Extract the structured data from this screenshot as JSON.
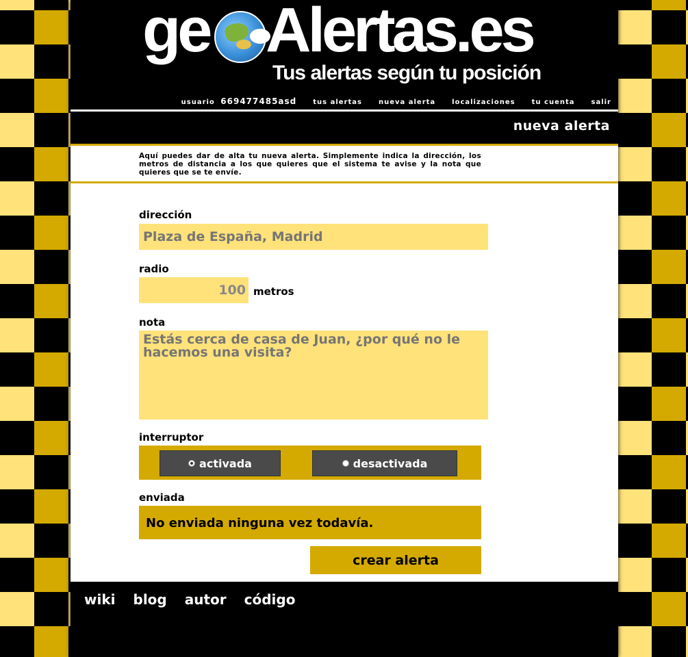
{
  "header": {
    "logo_geo": "ge",
    "logo_alertas": "Alertas.es",
    "tagline": "Tus alertas según tu posición"
  },
  "topnav": {
    "user_label": "usuario",
    "user_id": "669477485asd",
    "items": [
      "tus alertas",
      "nueva alerta",
      "localizaciones",
      "tu cuenta",
      "salir"
    ]
  },
  "page": {
    "title": "nueva alerta",
    "intro": "Aquí puedes dar de alta tu nueva alerta. Simplemente indica la dirección, los metros de distancia a los que quieres que el sistema te avise y la nota que quieres que se te envíe."
  },
  "form": {
    "direccion_label": "dirección",
    "direccion_placeholder": "Plaza de España, Madrid",
    "radio_label": "radio",
    "radio_value": "100",
    "radio_unit": "metros",
    "nota_label": "nota",
    "nota_placeholder": "Estás cerca de casa de Juan, ¿por qué no le hacemos una visita?",
    "interruptor_label": "interruptor",
    "switch_on": "activada",
    "switch_off": "desactivada",
    "switch_selected": "activada",
    "enviada_label": "enviada",
    "enviada_value": "No enviada ninguna vez todavía.",
    "submit_label": "crear alerta"
  },
  "footer": {
    "links": [
      "wiki",
      "blog",
      "autor",
      "código"
    ]
  },
  "colors": {
    "gold": "#d4aa00",
    "light_yellow": "#ffe27a",
    "black": "#000000",
    "switch_grey": "#4a4a4a"
  }
}
